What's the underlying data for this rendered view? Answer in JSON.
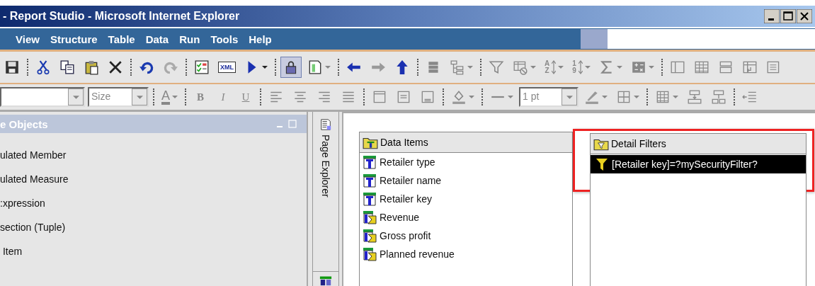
{
  "window": {
    "title": "- Report Studio - Microsoft Internet Explorer"
  },
  "menu": [
    "View",
    "Structure",
    "Table",
    "Data",
    "Run",
    "Tools",
    "Help"
  ],
  "toolbar_labels": {
    "xml": "XML",
    "sort_alpha": [
      "A",
      "Z"
    ],
    "sort_numeric": [
      "1",
      "9"
    ]
  },
  "format_bar": {
    "size_field": {
      "placeholder": "Size"
    },
    "font_color": "A",
    "styles": [
      "B",
      "I",
      "U"
    ],
    "line_width": {
      "value": "1 pt"
    }
  },
  "insertable_objects": {
    "title": "e Objects",
    "items": [
      "ulated Member",
      "ulated Measure",
      ":xpression",
      "section (Tuple)",
      " Item"
    ]
  },
  "side_tab": {
    "label": "Page Explorer"
  },
  "data_items": {
    "title": "Data Items",
    "items": [
      {
        "label": "Retailer type",
        "kind": "attribute"
      },
      {
        "label": "Retailer name",
        "kind": "attribute"
      },
      {
        "label": "Retailer key",
        "kind": "attribute"
      },
      {
        "label": "Revenue",
        "kind": "measure"
      },
      {
        "label": "Gross profit",
        "kind": "measure"
      },
      {
        "label": "Planned revenue",
        "kind": "measure"
      }
    ]
  },
  "detail_filters": {
    "title": "Detail Filters",
    "highlighted": true,
    "items": [
      {
        "label": "[Retailer key]=?mySecurityFilter?",
        "selected": true
      }
    ]
  }
}
